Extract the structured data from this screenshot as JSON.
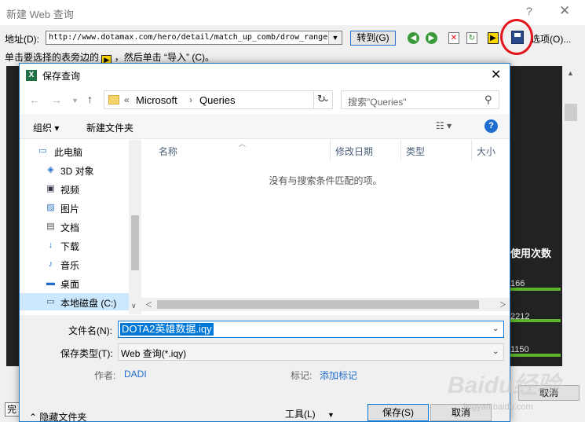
{
  "bg_window": {
    "title": "新建 Web 查询",
    "help": "?",
    "close": "✕",
    "address_label": "地址(D):",
    "address_value": "http://www.dotamax.com/hero/detail/match_up_comb/drow_ranger",
    "goto_label": "转到(G)",
    "options_label": "选项(O)...",
    "hint_prefix": "单击要选择的表旁边的",
    "hint_suffix": "，然后单击 “导入” (C)。",
    "usage_header": "使用次数",
    "usage_values": [
      "166",
      "2212",
      "1150"
    ],
    "cancel_label": "取消",
    "status_left": "完"
  },
  "dialog": {
    "title": "保存查询",
    "close": "✕",
    "breadcrumb": {
      "prefix": "«",
      "part1": "Microsoft",
      "sep": "›",
      "part2": "Queries"
    },
    "search_placeholder": "搜索\"Queries\"",
    "organize_label": "组织 ▾",
    "new_folder_label": "新建文件夹",
    "view_label": "☷ ▾",
    "help_label": "?",
    "nav_items": [
      {
        "label": "此电脑",
        "icon": "computer-icon"
      },
      {
        "label": "3D 对象",
        "icon": "3d-objects-icon"
      },
      {
        "label": "视频",
        "icon": "video-icon"
      },
      {
        "label": "图片",
        "icon": "pictures-icon"
      },
      {
        "label": "文档",
        "icon": "documents-icon"
      },
      {
        "label": "下载",
        "icon": "download-icon"
      },
      {
        "label": "音乐",
        "icon": "music-icon"
      },
      {
        "label": "桌面",
        "icon": "desktop-icon"
      },
      {
        "label": "本地磁盘 (C:)",
        "icon": "drive-icon"
      }
    ],
    "columns": [
      "名称",
      "修改日期",
      "类型",
      "大小"
    ],
    "empty_message": "没有与搜索条件匹配的项。",
    "filename_label": "文件名(N):",
    "filename_value": "DOTA2英雄数据.iqy",
    "filetype_label": "保存类型(T):",
    "filetype_value": "Web 查询(*.iqy)",
    "author_label": "作者:",
    "author_value": "DADI",
    "tags_label": "标记:",
    "tags_value": "添加标记",
    "hide_folders_label": "隐藏文件夹",
    "tools_label": "工具(L)",
    "save_label": "保存(S)",
    "cancel_label": "取消"
  },
  "watermark": {
    "text": "Baidu经验",
    "sub": "jingyan.baidu.com"
  }
}
